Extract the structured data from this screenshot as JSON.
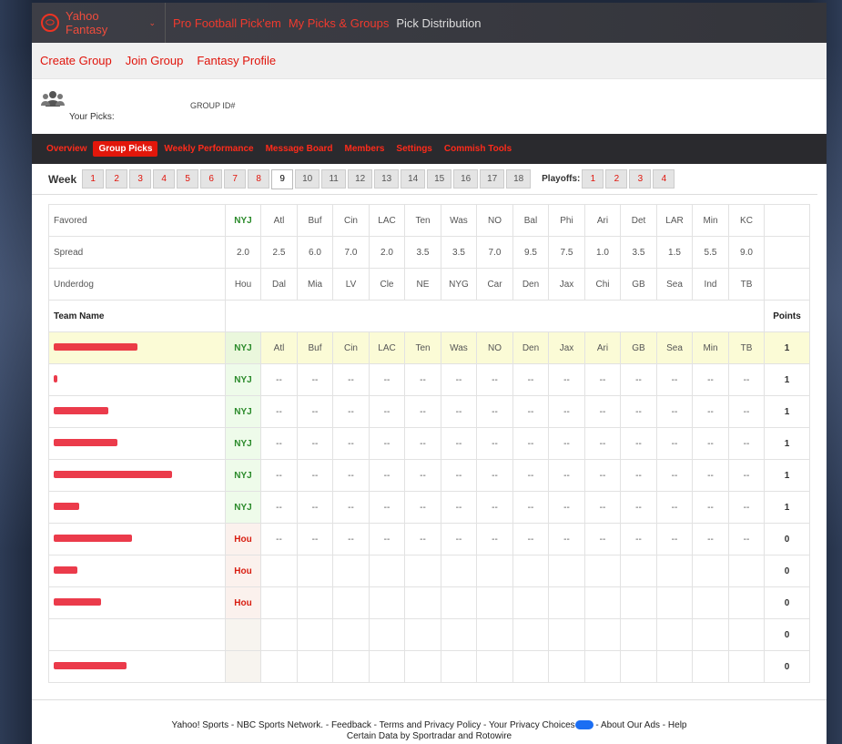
{
  "topnav": {
    "brand": "Yahoo Fantasy",
    "links": [
      "Pro Football Pick'em",
      "My Picks & Groups",
      "Pick Distribution"
    ]
  },
  "subnav": [
    "Create Group",
    "Join Group",
    "Fantasy Profile"
  ],
  "group": {
    "your_picks_label": "Your Picks:",
    "group_id_label": "GROUP ID#"
  },
  "tabs": [
    "Overview",
    "Group Picks",
    "Weekly Performance",
    "Message Board",
    "Members",
    "Settings",
    "Commish Tools"
  ],
  "weeks": {
    "label": "Week",
    "items": [
      "1",
      "2",
      "3",
      "4",
      "5",
      "6",
      "7",
      "8",
      "9",
      "10",
      "11",
      "12",
      "13",
      "14",
      "15",
      "16",
      "17",
      "18"
    ],
    "playoffs_label": "Playoffs:",
    "playoffs": [
      "1",
      "2",
      "3",
      "4"
    ]
  },
  "table": {
    "favored_label": "Favored",
    "spread_label": "Spread",
    "underdog_label": "Underdog",
    "team_name_label": "Team Name",
    "points_label": "Points",
    "favored": [
      "NYJ",
      "Atl",
      "Buf",
      "Cin",
      "LAC",
      "Ten",
      "Was",
      "NO",
      "Bal",
      "Phi",
      "Ari",
      "Det",
      "LAR",
      "Min",
      "KC"
    ],
    "spread": [
      "2.0",
      "2.5",
      "6.0",
      "7.0",
      "2.0",
      "3.5",
      "3.5",
      "7.0",
      "9.5",
      "7.5",
      "1.0",
      "3.5",
      "1.5",
      "5.5",
      "9.0"
    ],
    "underdog": [
      "Hou",
      "Dal",
      "Mia",
      "LV",
      "Cle",
      "NE",
      "NYG",
      "Car",
      "Den",
      "Jax",
      "Chi",
      "GB",
      "Sea",
      "Ind",
      "TB"
    ],
    "rows": [
      {
        "pick1": "NYJ",
        "picks": [
          "Atl",
          "Buf",
          "Cin",
          "LAC",
          "Ten",
          "Was",
          "NO",
          "Den",
          "Jax",
          "Ari",
          "GB",
          "Sea",
          "Min",
          "TB"
        ],
        "points": "1"
      },
      {
        "pick1": "NYJ",
        "picks": [
          "--",
          "--",
          "--",
          "--",
          "--",
          "--",
          "--",
          "--",
          "--",
          "--",
          "--",
          "--",
          "--",
          "--"
        ],
        "points": "1"
      },
      {
        "pick1": "NYJ",
        "picks": [
          "--",
          "--",
          "--",
          "--",
          "--",
          "--",
          "--",
          "--",
          "--",
          "--",
          "--",
          "--",
          "--",
          "--"
        ],
        "points": "1"
      },
      {
        "pick1": "NYJ",
        "picks": [
          "--",
          "--",
          "--",
          "--",
          "--",
          "--",
          "--",
          "--",
          "--",
          "--",
          "--",
          "--",
          "--",
          "--"
        ],
        "points": "1"
      },
      {
        "pick1": "NYJ",
        "picks": [
          "--",
          "--",
          "--",
          "--",
          "--",
          "--",
          "--",
          "--",
          "--",
          "--",
          "--",
          "--",
          "--",
          "--"
        ],
        "points": "1"
      },
      {
        "pick1": "NYJ",
        "picks": [
          "--",
          "--",
          "--",
          "--",
          "--",
          "--",
          "--",
          "--",
          "--",
          "--",
          "--",
          "--",
          "--",
          "--"
        ],
        "points": "1"
      },
      {
        "pick1": "Hou",
        "picks": [
          "--",
          "--",
          "--",
          "--",
          "--",
          "--",
          "--",
          "--",
          "--",
          "--",
          "--",
          "--",
          "--",
          "--"
        ],
        "points": "0"
      },
      {
        "pick1": "Hou",
        "picks": [
          "",
          "",
          "",
          "",
          "",
          "",
          "",
          "",
          "",
          "",
          "",
          "",
          "",
          ""
        ],
        "points": "0"
      },
      {
        "pick1": "Hou",
        "picks": [
          "",
          "",
          "",
          "",
          "",
          "",
          "",
          "",
          "",
          "",
          "",
          "",
          "",
          ""
        ],
        "points": "0"
      },
      {
        "pick1": "",
        "picks": [
          "",
          "",
          "",
          "",
          "",
          "",
          "",
          "",
          "",
          "",
          "",
          "",
          "",
          ""
        ],
        "points": "0"
      },
      {
        "pick1": "",
        "picks": [
          "",
          "",
          "",
          "",
          "",
          "",
          "",
          "",
          "",
          "",
          "",
          "",
          "",
          ""
        ],
        "points": "0"
      }
    ]
  },
  "footer": {
    "line1_a": "Yahoo! Sports - NBC Sports Network. - Feedback - Terms and Privacy Policy - Your Privacy Choices",
    "line1_b": " - About Our Ads - Help",
    "line2": "Certain Data by Sportradar and Rotowire"
  },
  "colors": {
    "brand_red": "#e0140b",
    "nav_dark": "#3a3a40",
    "pick_green": "#2a8a2a"
  }
}
